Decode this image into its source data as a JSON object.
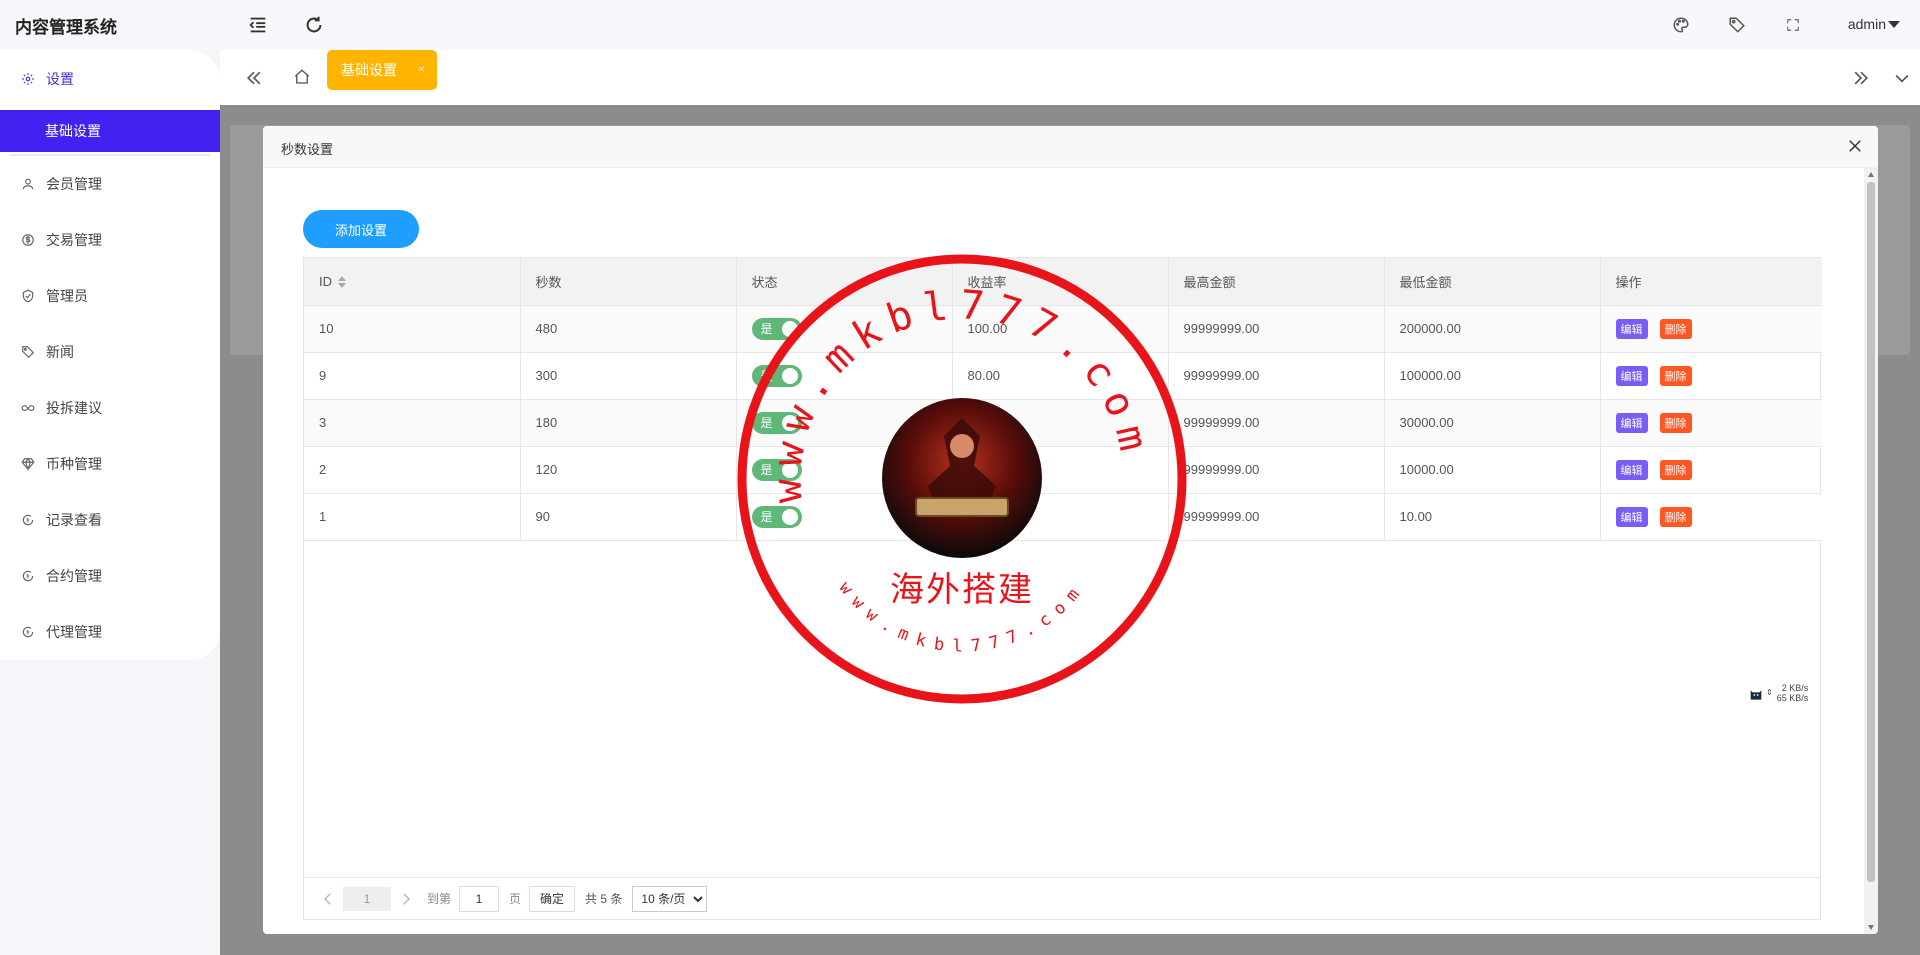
{
  "app": {
    "title": "内容管理系统",
    "user": "admin"
  },
  "sidebar": {
    "items": [
      {
        "label": "设置",
        "icon": "gear-icon"
      },
      {
        "label": "基础设置",
        "icon": ""
      },
      {
        "label": "会员管理",
        "icon": "user-icon"
      },
      {
        "label": "交易管理",
        "icon": "dollar-icon"
      },
      {
        "label": "管理员",
        "icon": "shield-icon"
      },
      {
        "label": "新闻",
        "icon": "tag-icon"
      },
      {
        "label": "投拆建议",
        "icon": "link-icon"
      },
      {
        "label": "币种管理",
        "icon": "diamond-icon"
      },
      {
        "label": "记录查看",
        "icon": "refresh-icon"
      },
      {
        "label": "合约管理",
        "icon": "refresh-icon"
      },
      {
        "label": "代理管理",
        "icon": "refresh-icon"
      }
    ]
  },
  "tabs": {
    "active": "基础设置",
    "close_glyph": "×"
  },
  "modal": {
    "title": "秒数设置",
    "add_button": "添加设置",
    "columns": [
      "ID",
      "秒数",
      "状态",
      "收益率",
      "最高金额",
      "最低金额",
      "操作"
    ],
    "rows": [
      {
        "id": "10",
        "seconds": "480",
        "status": "是",
        "rate": "100.00",
        "max": "99999999.00",
        "min": "200000.00"
      },
      {
        "id": "9",
        "seconds": "300",
        "status": "是",
        "rate": "80.00",
        "max": "99999999.00",
        "min": "100000.00"
      },
      {
        "id": "3",
        "seconds": "180",
        "status": "是",
        "rate": "",
        "max": "99999999.00",
        "min": "30000.00"
      },
      {
        "id": "2",
        "seconds": "120",
        "status": "是",
        "rate": "",
        "max": "99999999.00",
        "min": "10000.00"
      },
      {
        "id": "1",
        "seconds": "90",
        "status": "是",
        "rate": "",
        "max": "99999999.00",
        "min": "10.00"
      }
    ],
    "edit_label": "编辑",
    "delete_label": "删除",
    "pager": {
      "current": "1",
      "goto_label": "到第",
      "page_input": "1",
      "page_unit": "页",
      "confirm": "确定",
      "total": "共 5 条",
      "page_size": "10 条/页"
    }
  },
  "speed": {
    "up": "2 KB/s",
    "down": "65 KB/s"
  },
  "watermark": {
    "url_top": "www.mkbl777.com",
    "url_bottom": "www.mkbl777.com",
    "cn_text": "海外搭建"
  },
  "colors": {
    "accent": "#4122f0",
    "tab_active": "#ffb400",
    "primary_button": "#1e9fff",
    "switch_on": "#5fb878",
    "edit_button": "#7b5cf5",
    "delete_button": "#ff5722",
    "stamp_red": "#e8141a"
  }
}
